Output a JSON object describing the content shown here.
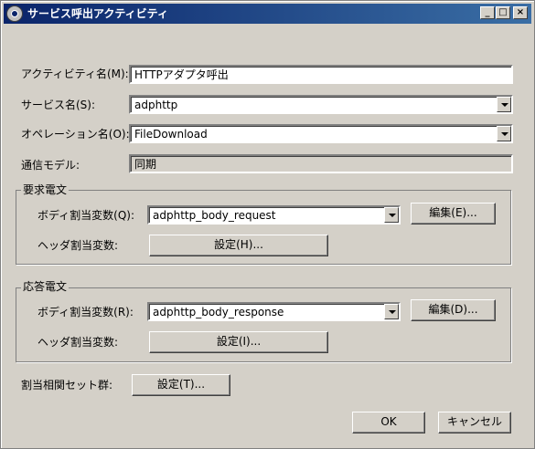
{
  "window": {
    "title": "サービス呼出アクティビティ",
    "controls": [
      "_",
      "□",
      "×"
    ]
  },
  "form": {
    "activity_name_label": "アクティビティ名(M):",
    "activity_name_value": "HTTPアダプタ呼出",
    "service_name_label": "サービス名(S):",
    "service_name_value": "adphttp",
    "operation_name_label": "オペレーション名(O):",
    "operation_name_value": "FileDownload",
    "comm_model_label": "通信モデル:",
    "comm_model_value": "同期"
  },
  "request_group": {
    "title": "要求電文",
    "body_label": "ボディ割当変数(Q):",
    "body_value": "adphttp_body_request",
    "edit_button": "編集(E)...",
    "header_label": "ヘッダ割当変数:",
    "header_button": "設定(H)..."
  },
  "response_group": {
    "title": "応答電文",
    "body_label": "ボディ割当変数(R):",
    "body_value": "adphttp_body_response",
    "edit_button": "編集(D)...",
    "header_label": "ヘッダ割当変数:",
    "header_button": "設定(I)..."
  },
  "correlation": {
    "label": "割当相関セット群:",
    "button": "設定(T)..."
  },
  "footer": {
    "ok": "OK",
    "cancel": "キャンセル"
  }
}
